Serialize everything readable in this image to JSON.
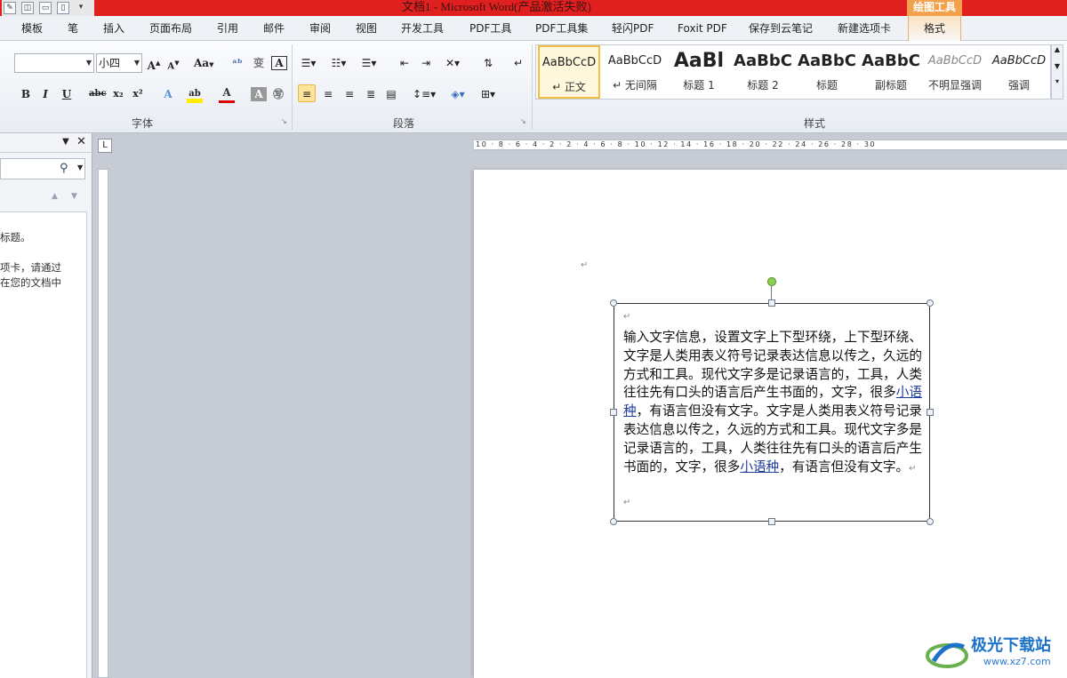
{
  "titlebar": {
    "title": "文档1  -  Microsoft Word(产品激活失败)",
    "context_group": "绘图工具"
  },
  "tabs": [
    "模板",
    "笔",
    "插入",
    "页面布局",
    "引用",
    "邮件",
    "审阅",
    "视图",
    "开发工具",
    "PDF工具",
    "PDF工具集",
    "轻闪PDF",
    "Foxit PDF",
    "保存到云笔记",
    "新建选项卡"
  ],
  "context_tab": "格式",
  "font": {
    "name_value": "",
    "size_value": "小四",
    "grow": "A",
    "shrink": "A",
    "case": "Aa",
    "bold": "B",
    "italic": "I",
    "underline": "U",
    "strike": "abc",
    "subscript": "x₂",
    "superscript": "x²",
    "group_label": "字体"
  },
  "paragraph": {
    "group_label": "段落"
  },
  "styles": {
    "group_label": "样式",
    "items": [
      {
        "sample": "AaBbCcD",
        "name": "↵ 正文"
      },
      {
        "sample": "AaBbCcD",
        "name": "↵ 无间隔"
      },
      {
        "sample": "AaBl",
        "name": "标题 1"
      },
      {
        "sample": "AaBbC",
        "name": "标题 2"
      },
      {
        "sample": "AaBbC",
        "name": "标题"
      },
      {
        "sample": "AaBbC",
        "name": "副标题"
      },
      {
        "sample": "AaBbCcD",
        "name": "不明显强调"
      },
      {
        "sample": "AaBbCcD",
        "name": "强调"
      }
    ]
  },
  "navpane": {
    "line1": "标题。",
    "line2": "项卡，请通过",
    "line3": "在您的文档中"
  },
  "ruler": {
    "marks": "10 · 8 · 6 · 4 · 2 · 2 · 4 · 6 · 8 · 10 · 12 · 14 · 16 · 18 · 20 · 22 · 24 · 26 · 28 · 30"
  },
  "document": {
    "para_mark": "↵",
    "textbox_text_a": "输入文字信息，设置文字上下型环绕，上下型环绕、文字是人类用表义符号记录表达信息以传之，久远的方式和工具。现代文字多是记录语言的，工具，人类往往先有口头的语言后产生书面的，文字，很多",
    "link1": "小语种",
    "textbox_text_b": "，有语言但没有文字。文字是人类用表义符号记录表达信息以传之，久远的方式和工具。现代文字多是记录语言的，工具，人类往往先有口头的语言后产生书面的，文字，很多",
    "link2": "小语种",
    "textbox_text_c": "，有语言但没有文字。"
  },
  "watermark": {
    "title": "极光下载站",
    "url": "www.xz7.com"
  }
}
